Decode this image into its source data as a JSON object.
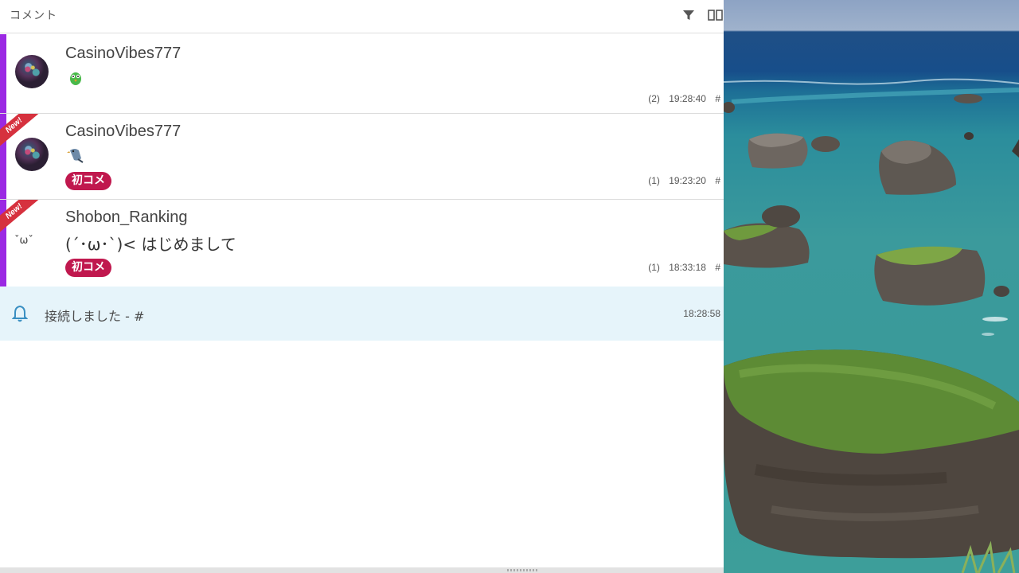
{
  "header": {
    "title": "コメント",
    "filter_icon": "filter-icon",
    "columns_icon": "columns-icon"
  },
  "comments": [
    {
      "username": "CasinoVibes777",
      "message": "",
      "emoji_icon": "parrot-emoji-icon",
      "new": false,
      "first_comment": false,
      "count": "(2)",
      "time": "19:28:40",
      "hash": "#",
      "accent_color": "#9b29e3"
    },
    {
      "username": "CasinoVibes777",
      "message": "",
      "emoji_icon": "bird-emoji-icon",
      "new": true,
      "new_label": "New!",
      "first_comment": true,
      "first_label": "初コメ",
      "count": "(1)",
      "time": "19:23:20",
      "hash": "#",
      "accent_color": "#9b29e3"
    },
    {
      "username": "Shobon_Ranking",
      "message": "(´･ω･`)< はじめまして",
      "avatar_text": "ˇωˇ",
      "new": true,
      "new_label": "New!",
      "first_comment": true,
      "first_label": "初コメ",
      "count": "(1)",
      "time": "18:33:18",
      "hash": "#",
      "accent_color": "#9b29e3"
    }
  ],
  "system": {
    "icon": "bell-icon",
    "text": "接続しました - #",
    "time": "18:28:58"
  },
  "colors": {
    "accent": "#9b29e3",
    "badge": "#c0184e",
    "new_ribbon": "#d6313e",
    "system_bg": "#e6f4fa"
  }
}
